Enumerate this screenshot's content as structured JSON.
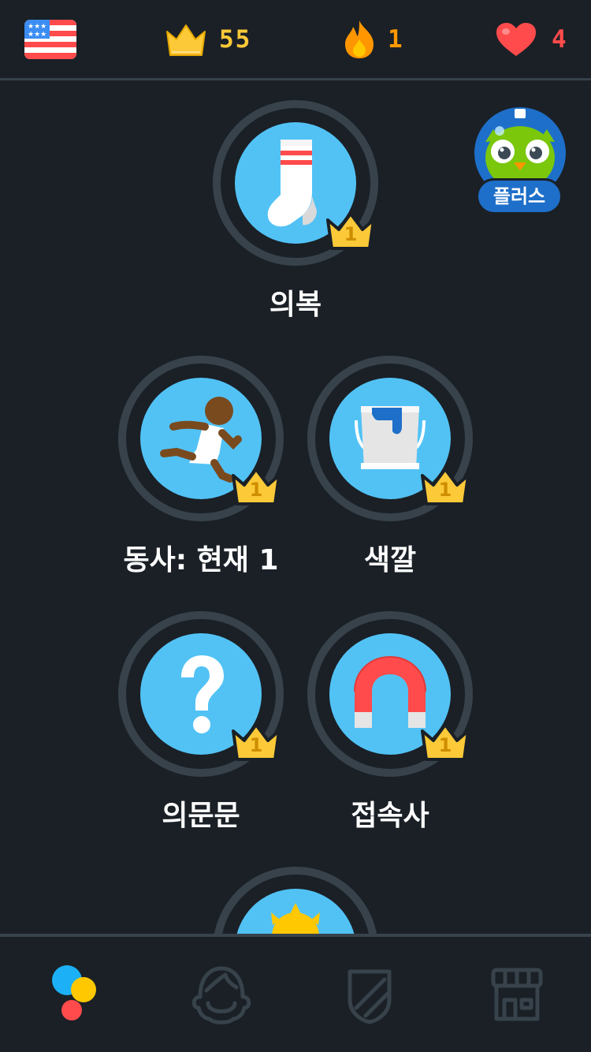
{
  "topbar": {
    "flag_icon": "us-flag-icon",
    "crowns": {
      "icon": "crown-icon",
      "value": "55",
      "color": "#fcc938"
    },
    "streak": {
      "icon": "flame-icon",
      "value": "1",
      "color": "#ff9800"
    },
    "hearts": {
      "icon": "heart-icon",
      "value": "4",
      "color": "#ff4b4b"
    }
  },
  "plus_badge": {
    "label": "플러스",
    "icon": "owl-icon"
  },
  "skills": [
    {
      "label": "의복",
      "icon": "sock-icon",
      "level": "1"
    },
    {
      "label": "동사: 현재 1",
      "icon": "runner-icon",
      "level": "1"
    },
    {
      "label": "색깔",
      "icon": "paint-bucket-icon",
      "level": "1"
    },
    {
      "label": "의문문",
      "icon": "question-mark-icon",
      "level": "1"
    },
    {
      "label": "접속사",
      "icon": "magnet-icon",
      "level": "1"
    },
    {
      "label": "",
      "icon": "sun-icon",
      "level": ""
    }
  ],
  "bottom_nav": [
    {
      "icon": "learn-icon",
      "active": true
    },
    {
      "icon": "profile-icon",
      "active": false
    },
    {
      "icon": "league-shield-icon",
      "active": false
    },
    {
      "icon": "shop-icon",
      "active": false
    }
  ],
  "colors": {
    "background": "#1a2026",
    "skill_blue": "#52c2f5",
    "ring": "#37424b",
    "gold": "#fcc938"
  }
}
